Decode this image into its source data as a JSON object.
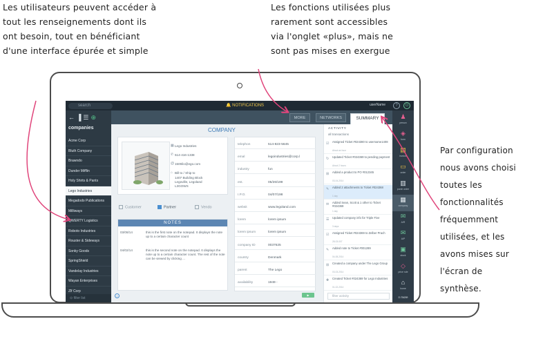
{
  "callouts": {
    "left": "Les utilisateurs peuvent accéder à\ntout les renseignements dont ils\nont besoin, tout en bénéficiant\nd'une interface épurée et simple",
    "top": "Les fonctions utilisées plus\nrarement sont accessibles\nvia l'onglet «plus», mais ne\nsont pas mises en exergue",
    "right": "Par configuration\nnous avons choisi\ntoutes les\nfonctionnalités\nfréquemment\nutilisées, et les\navons mises sur\nl'écran de\nsynthèse."
  },
  "colors": {
    "accent_arrow": "#e0457b",
    "sidebar": "#2d3a44",
    "accent_blue": "#3a78b5"
  },
  "topbar": {
    "search_placeholder": "search",
    "notifications": "NOTIFICATIONS",
    "username": "userName"
  },
  "sidebar": {
    "heading": "companies",
    "companies": [
      "Acme Corp",
      "Bluth Company",
      "Brawndo",
      "Dunder Mifflin",
      "Holy Shirts & Pants",
      "Lego Industries",
      "Megadodo Publications",
      "Milliways",
      "QWERTY Logistics",
      "Roboto Industries",
      "Rouster & Sideways",
      "Sonky Goods",
      "SpringShield",
      "Vandelay Industries",
      "Wayan Enterprises",
      "Zlf Corp"
    ],
    "active_company": "Lego Industries",
    "filter_placeholder": "filter list"
  },
  "tabs": {
    "more": "MORE",
    "networks": "NETWORKS",
    "summary": "SUMMARY"
  },
  "company": {
    "title": "COMPANY",
    "name": "Lego Industries",
    "phone": "514-416-1338",
    "email": "1500ilo@ego.com",
    "billto": "Bill to",
    "shipto": "Ship to",
    "address": "1407 Building Block\nLegoville, Legoland\nL3GOWS",
    "types": [
      "Customer",
      "Partner",
      "Vendo"
    ],
    "selected_type": "Partner"
  },
  "notes": {
    "header": "NOTES",
    "items": [
      {
        "date": "03/08/14",
        "text": "this is the first note on the notepad. It displays the note up to a certain character count"
      },
      {
        "date": "04/02/14",
        "text": "this is the second note on the notepad. It displays the note up to a certain character count. The rest of the note can be viewed by clicking ..."
      }
    ]
  },
  "details": [
    {
      "label": "telephon",
      "value": "514-823-5645"
    },
    {
      "label": "emal",
      "value": "legoindustries@corp.l"
    },
    {
      "label": "industry",
      "value": "fun"
    },
    {
      "label": "est.",
      "value": "05/26/199"
    },
    {
      "label": "I.P.O.",
      "value": "04/07/198"
    },
    {
      "label": "websit",
      "value": "www.legoland.com"
    },
    {
      "label": "lorem",
      "value": "lorem ipsum"
    },
    {
      "label": "lorem ipsum",
      "value": "lorem ipsum"
    },
    {
      "label": "company ID",
      "value": "0037625"
    },
    {
      "label": "country",
      "value": "Denmark"
    },
    {
      "label": "parent",
      "value": "The Lego"
    },
    {
      "label": "availability",
      "value": "1949 -"
    }
  ],
  "activity": {
    "title": "ACTIVITY",
    "filter_label": "all transactions",
    "items": [
      {
        "title": "Assigned Ticket #024380 to username1408",
        "time": "About an hour"
      },
      {
        "title": "Updated Ticket #024369 to pending payment",
        "time": "About 2 hours"
      },
      {
        "title": "Added a product to PO #012345",
        "time": "03-04-2014"
      },
      {
        "title": "Added 2 attachments to Ticket #024368",
        "time": "1 day"
      },
      {
        "title": "Added Sean, Scott & 1 other to Ticket #024369",
        "time": "1 day"
      },
      {
        "title": "Updated company info for Triple Five",
        "time": "3 days"
      },
      {
        "title": "Assigned Ticket #024369 to Zelber Prach",
        "time": "28-03-007"
      },
      {
        "title": "Added note to Ticket #001289",
        "time": "04-08-2014"
      },
      {
        "title": "Created a company under The Lego Group",
        "time": "03-03-2014"
      },
      {
        "title": "Created Ticket #024369 for Lego Industries",
        "time": "01-02-2014"
      }
    ],
    "active_index": 3,
    "filter_placeholder": "filter activity"
  },
  "right_nav": [
    {
      "label": "person",
      "icon": "person-icon"
    },
    {
      "label": "form",
      "icon": "tag-icon"
    },
    {
      "label": "invoice",
      "icon": "invoice-icon"
    },
    {
      "label": "order",
      "icon": "order-icon"
    },
    {
      "label": "purch order",
      "icon": "purchase-order-icon"
    },
    {
      "label": "company",
      "icon": "company-icon"
    },
    {
      "label": "A/R",
      "icon": "ar-icon"
    },
    {
      "label": "A/P",
      "icon": "ap-icon"
    },
    {
      "label": "stock",
      "icon": "stock-icon"
    },
    {
      "label": "price rule",
      "icon": "price-rule-icon"
    },
    {
      "label": "home",
      "icon": "home-icon"
    }
  ],
  "more_link": "≡ more"
}
